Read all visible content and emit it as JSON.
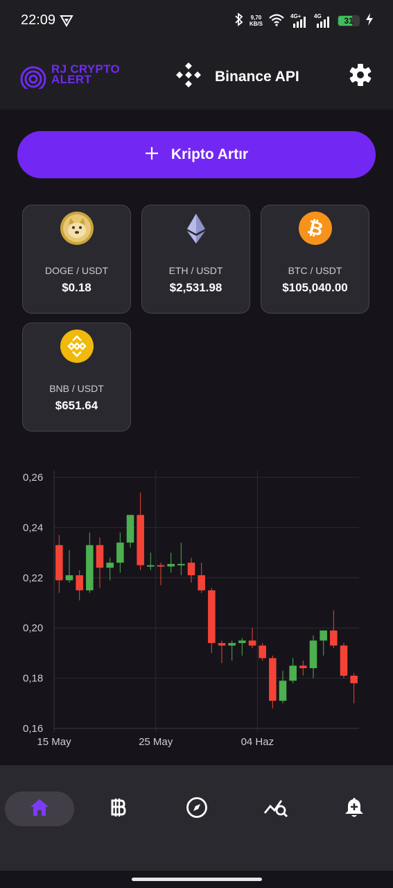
{
  "status_bar": {
    "time": "22:09",
    "net_speed_value": "9,70",
    "net_speed_unit": "KB/S",
    "sim1_label": "4G+",
    "sim2_label": "4G",
    "battery_level": "31",
    "icons": [
      "vpn-icon",
      "bluetooth-icon",
      "wifi-icon",
      "signal-icon",
      "battery-icon",
      "charging-icon"
    ]
  },
  "header": {
    "logo_text_line1": "RJ CRYPTO",
    "logo_text_line2": "ALERT",
    "exchange_name": "Binance API",
    "icons": [
      "binance-icon",
      "gear-icon"
    ]
  },
  "add_button": {
    "label": "Kripto Artır",
    "icon": "plus-icon"
  },
  "coins": [
    {
      "pair": "DOGE / USDT",
      "price": "$0.18",
      "icon": "doge-icon",
      "color": "#c9a53a"
    },
    {
      "pair": "ETH / USDT",
      "price": "$2,531.98",
      "icon": "eth-icon",
      "color": "#8f93c9"
    },
    {
      "pair": "BTC / USDT",
      "price": "$105,040.00",
      "icon": "btc-icon",
      "color": "#f7931a"
    },
    {
      "pair": "BNB / USDT",
      "price": "$651.64",
      "icon": "bnb-icon",
      "color": "#f0b90b"
    }
  ],
  "chart_data": {
    "type": "candlestick",
    "x_tick_labels": [
      "15 May",
      "25 May",
      "04 Haz"
    ],
    "y_tick_labels": [
      "0,26",
      "0,24",
      "0,22",
      "0,20",
      "0,18",
      "0,16"
    ],
    "ylim": [
      0.16,
      0.26
    ],
    "grid": true,
    "up_color": "#4caf50",
    "down_color": "#f44336",
    "candles": [
      {
        "o": 0.233,
        "h": 0.237,
        "l": 0.214,
        "c": 0.219
      },
      {
        "o": 0.219,
        "h": 0.231,
        "l": 0.218,
        "c": 0.221
      },
      {
        "o": 0.221,
        "h": 0.223,
        "l": 0.211,
        "c": 0.215
      },
      {
        "o": 0.215,
        "h": 0.238,
        "l": 0.214,
        "c": 0.233
      },
      {
        "o": 0.233,
        "h": 0.236,
        "l": 0.216,
        "c": 0.224
      },
      {
        "o": 0.224,
        "h": 0.228,
        "l": 0.219,
        "c": 0.226
      },
      {
        "o": 0.226,
        "h": 0.238,
        "l": 0.222,
        "c": 0.234
      },
      {
        "o": 0.234,
        "h": 0.245,
        "l": 0.232,
        "c": 0.245
      },
      {
        "o": 0.245,
        "h": 0.254,
        "l": 0.223,
        "c": 0.225
      },
      {
        "o": 0.225,
        "h": 0.23,
        "l": 0.223,
        "c": 0.225
      },
      {
        "o": 0.225,
        "h": 0.226,
        "l": 0.217,
        "c": 0.2245
      },
      {
        "o": 0.2245,
        "h": 0.23,
        "l": 0.222,
        "c": 0.2255
      },
      {
        "o": 0.2255,
        "h": 0.234,
        "l": 0.221,
        "c": 0.2255
      },
      {
        "o": 0.226,
        "h": 0.228,
        "l": 0.218,
        "c": 0.221
      },
      {
        "o": 0.221,
        "h": 0.226,
        "l": 0.214,
        "c": 0.215
      },
      {
        "o": 0.215,
        "h": 0.216,
        "l": 0.19,
        "c": 0.194
      },
      {
        "o": 0.194,
        "h": 0.195,
        "l": 0.186,
        "c": 0.193
      },
      {
        "o": 0.193,
        "h": 0.195,
        "l": 0.187,
        "c": 0.194
      },
      {
        "o": 0.194,
        "h": 0.196,
        "l": 0.189,
        "c": 0.195
      },
      {
        "o": 0.195,
        "h": 0.2,
        "l": 0.192,
        "c": 0.193
      },
      {
        "o": 0.193,
        "h": 0.194,
        "l": 0.187,
        "c": 0.188
      },
      {
        "o": 0.188,
        "h": 0.189,
        "l": 0.168,
        "c": 0.171
      },
      {
        "o": 0.171,
        "h": 0.183,
        "l": 0.17,
        "c": 0.179
      },
      {
        "o": 0.179,
        "h": 0.188,
        "l": 0.178,
        "c": 0.185
      },
      {
        "o": 0.185,
        "h": 0.187,
        "l": 0.181,
        "c": 0.184
      },
      {
        "o": 0.184,
        "h": 0.197,
        "l": 0.18,
        "c": 0.195
      },
      {
        "o": 0.195,
        "h": 0.199,
        "l": 0.189,
        "c": 0.199
      },
      {
        "o": 0.199,
        "h": 0.207,
        "l": 0.192,
        "c": 0.193
      },
      {
        "o": 0.193,
        "h": 0.194,
        "l": 0.18,
        "c": 0.181
      },
      {
        "o": 0.181,
        "h": 0.182,
        "l": 0.17,
        "c": 0.178
      }
    ]
  },
  "bottom_nav": {
    "items": [
      {
        "icon": "home-icon",
        "active": true
      },
      {
        "icon": "bitcoin-icon",
        "active": false
      },
      {
        "icon": "compass-icon",
        "active": false
      },
      {
        "icon": "chart-search-icon",
        "active": false
      },
      {
        "icon": "bell-plus-icon",
        "active": false
      }
    ],
    "active_color": "#7a3cf5",
    "inactive_color": "#ffffff"
  }
}
